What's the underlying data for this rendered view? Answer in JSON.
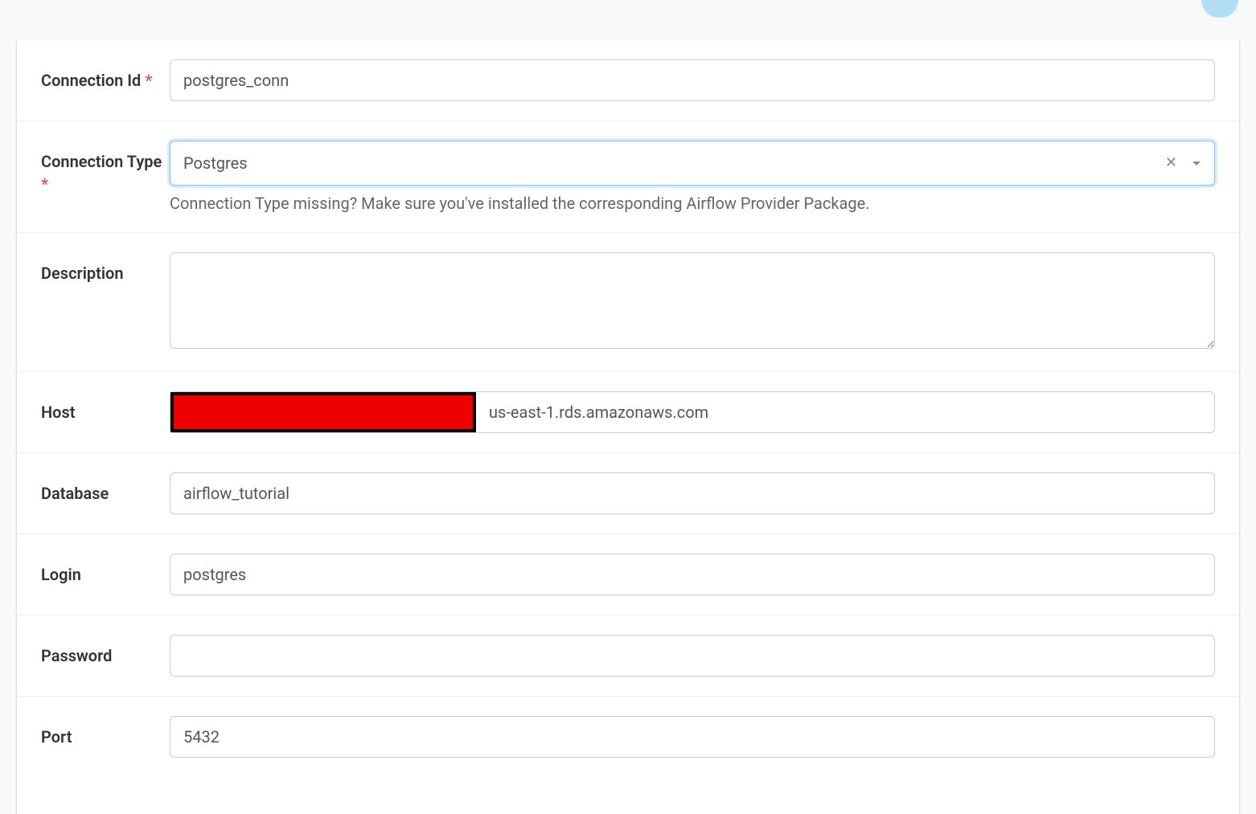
{
  "form": {
    "connection_id": {
      "label": "Connection Id",
      "required_mark": "*",
      "value": "postgres_conn"
    },
    "connection_type": {
      "label": "Connection Type",
      "required_mark": "*",
      "value": "Postgres",
      "helper": "Connection Type missing? Make sure you've installed the corresponding Airflow Provider Package."
    },
    "description": {
      "label": "Description",
      "value": ""
    },
    "host": {
      "label": "Host",
      "value": "us-east-1.rds.amazonaws.com"
    },
    "database": {
      "label": "Database",
      "value": "airflow_tutorial"
    },
    "login": {
      "label": "Login",
      "value": "postgres"
    },
    "password": {
      "label": "Password",
      "value": ""
    },
    "port": {
      "label": "Port",
      "value": "5432"
    }
  }
}
